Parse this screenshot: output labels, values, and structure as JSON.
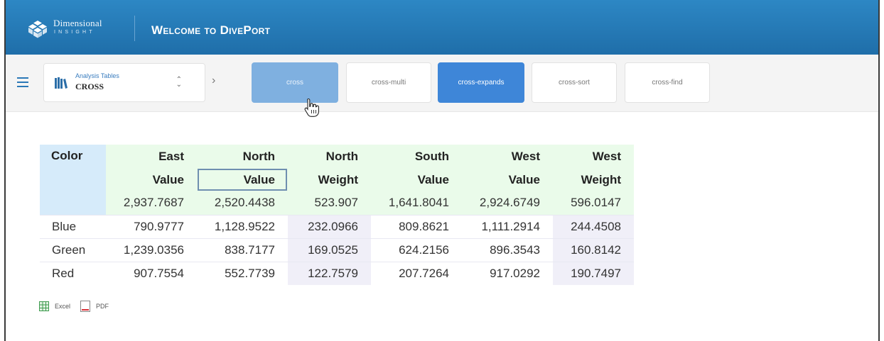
{
  "header": {
    "brand_top": "Dimensional",
    "brand_bottom": "INSIGHT",
    "title": "Welcome to DivePort"
  },
  "toolbar": {
    "menu_icon": "hamburger-menu-icon",
    "selector": {
      "caption": "Analysis Tables",
      "value": "CROSS",
      "icon": "book-icon"
    },
    "tabs": [
      {
        "label": "cross",
        "state": "hover"
      },
      {
        "label": "cross-multi",
        "state": "normal"
      },
      {
        "label": "cross-expands",
        "state": "active"
      },
      {
        "label": "cross-sort",
        "state": "normal"
      },
      {
        "label": "cross-find",
        "state": "normal"
      }
    ]
  },
  "table": {
    "corner": "Color",
    "columns": [
      {
        "top": "East",
        "bottom": "Value",
        "total": "2,937.7687"
      },
      {
        "top": "North",
        "bottom": "Value",
        "total": "2,520.4438"
      },
      {
        "top": "North",
        "bottom": "Weight",
        "total": "523.907"
      },
      {
        "top": "South",
        "bottom": "Value",
        "total": "1,641.8041"
      },
      {
        "top": "West",
        "bottom": "Value",
        "total": "2,924.6749"
      },
      {
        "top": "West",
        "bottom": "Weight",
        "total": "596.0147"
      }
    ],
    "rows": [
      {
        "label": "Blue",
        "values": [
          "790.9777",
          "1,128.9522",
          "232.0966",
          "809.8621",
          "1,111.2914",
          "244.4508"
        ]
      },
      {
        "label": "Green",
        "values": [
          "1,239.0356",
          "838.7177",
          "169.0525",
          "624.2156",
          "896.3543",
          "160.8142"
        ]
      },
      {
        "label": "Red",
        "values": [
          "907.7554",
          "552.7739",
          "122.7579",
          "207.7264",
          "917.0292",
          "190.7497"
        ]
      }
    ]
  },
  "export": {
    "excel_label": "Excel",
    "pdf_label": "PDF"
  },
  "colors": {
    "header_bg": "#2579b8",
    "tab_active": "#3e86d8",
    "tab_hover": "#7fb0e0",
    "table_header_green": "#eafbea",
    "table_corner_blue": "#d6ebfa"
  }
}
